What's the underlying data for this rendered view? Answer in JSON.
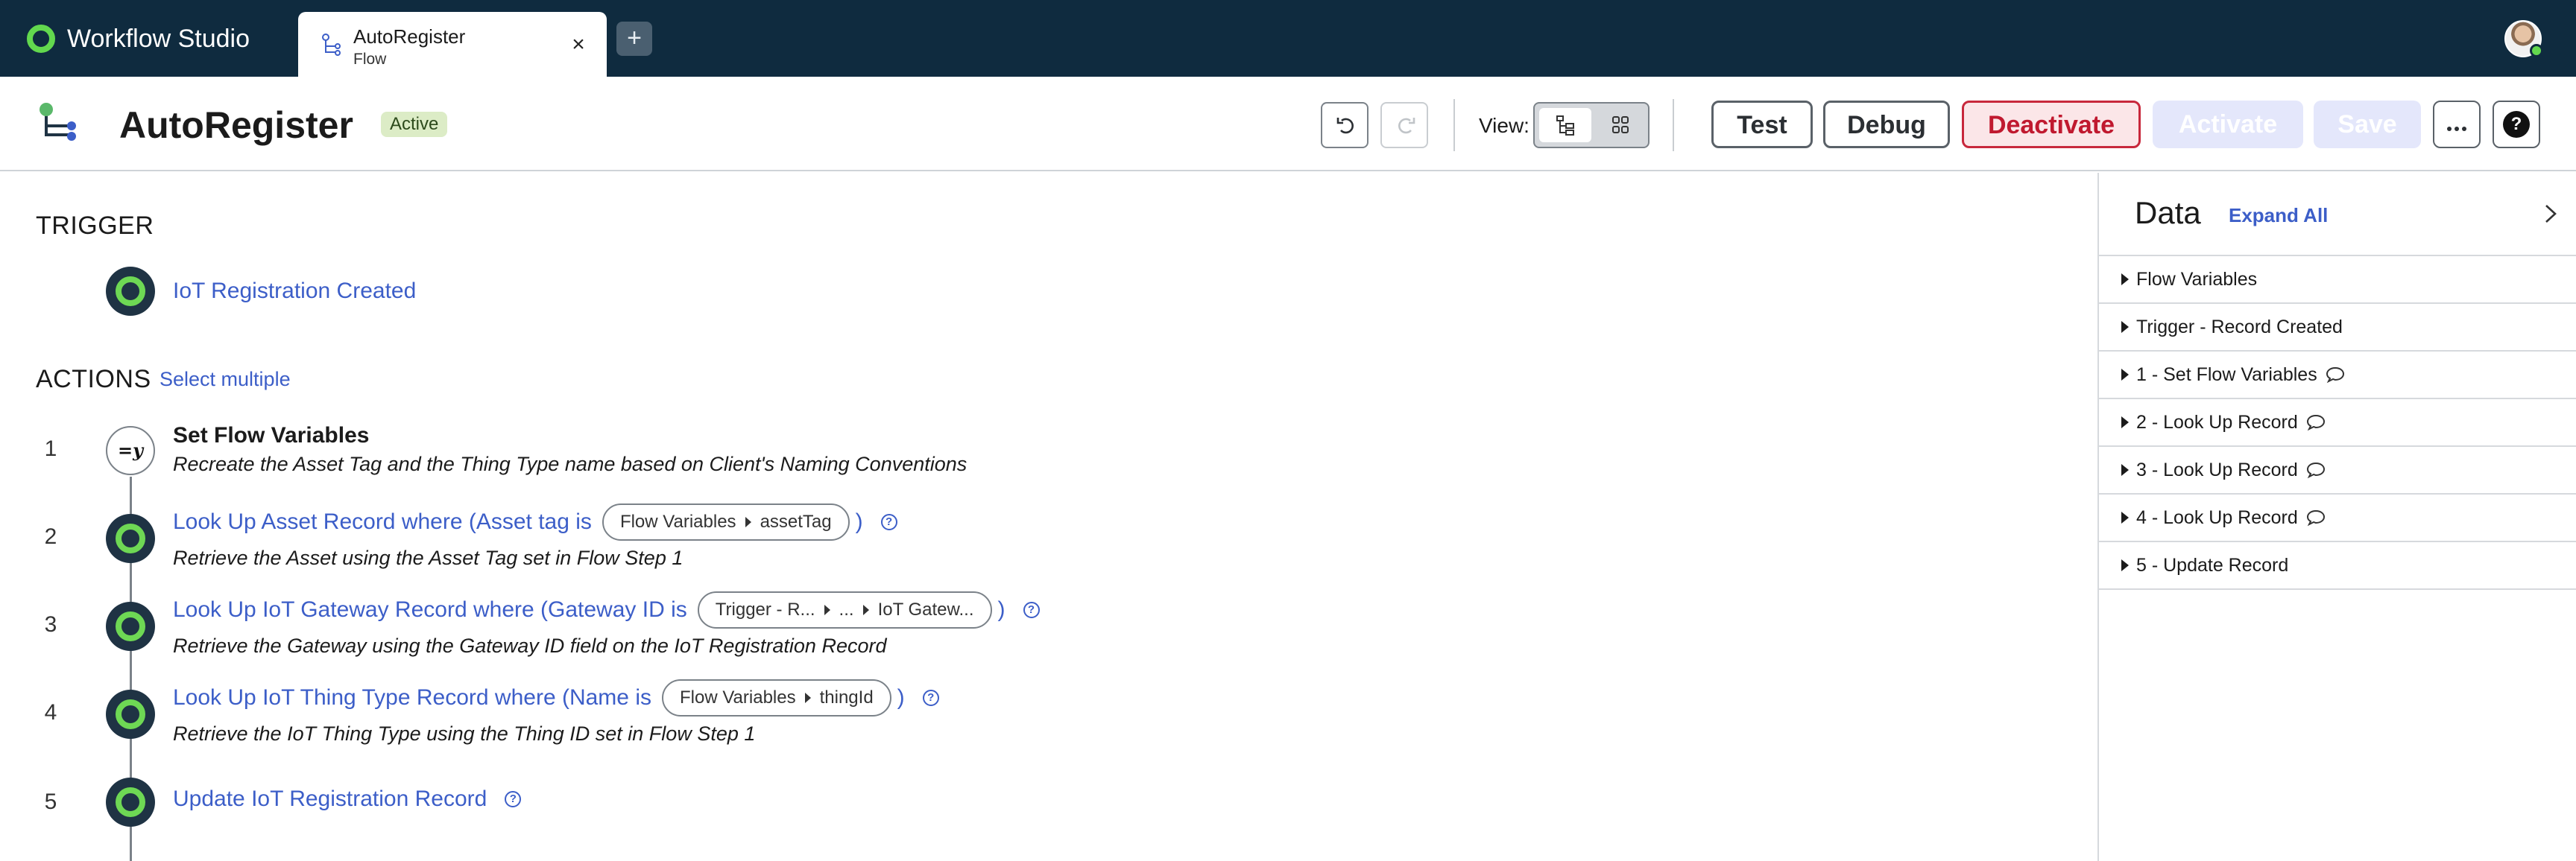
{
  "app": {
    "name": "Workflow Studio",
    "tab": {
      "title": "AutoRegister",
      "subtitle": "Flow",
      "close": "×"
    },
    "new_tab": "+"
  },
  "header": {
    "flow_name": "AutoRegister",
    "status": "Active",
    "view_label": "View:",
    "buttons": {
      "test": "Test",
      "debug": "Debug",
      "deactivate": "Deactivate",
      "activate": "Activate",
      "save": "Save",
      "help": "?"
    }
  },
  "canvas": {
    "trigger_heading": "TRIGGER",
    "trigger": {
      "label": "IoT Registration Created"
    },
    "actions_heading": "ACTIONS",
    "select_multiple": "Select multiple",
    "actions": [
      {
        "number": "1",
        "icon_text": "=y",
        "title": "Set Flow Variables",
        "description": "Recreate the Asset Tag and the Thing Type name based on Client's Naming Conventions"
      },
      {
        "number": "2",
        "title": "Look Up Asset Record where (Asset tag is",
        "pill": [
          "Flow Variables",
          "assetTag"
        ],
        "close_paren": ")",
        "description": "Retrieve the Asset using the Asset Tag set in Flow Step 1"
      },
      {
        "number": "3",
        "title": "Look Up IoT Gateway Record where (Gateway ID is",
        "pill": [
          "Trigger - R...",
          "...",
          "IoT Gatew..."
        ],
        "close_paren": ")",
        "description": "Retrieve the Gateway using the Gateway ID field on the IoT Registration Record"
      },
      {
        "number": "4",
        "title": "Look Up IoT Thing Type Record where (Name is",
        "pill": [
          "Flow Variables",
          "thingId"
        ],
        "close_paren": ")",
        "description": "Retrieve the IoT Thing Type using the Thing ID set in Flow Step 1"
      },
      {
        "number": "5",
        "title": "Update IoT Registration Record"
      }
    ],
    "help_glyph": "?"
  },
  "data_panel": {
    "title": "Data",
    "expand_all": "Expand All",
    "items": [
      {
        "label": "Flow Variables",
        "has_comment": false
      },
      {
        "label": "Trigger - Record Created",
        "has_comment": false
      },
      {
        "label": "1 - Set Flow Variables",
        "has_comment": true
      },
      {
        "label": "2 - Look Up Record",
        "has_comment": true
      },
      {
        "label": "3 - Look Up Record",
        "has_comment": true
      },
      {
        "label": "4 - Look Up Record",
        "has_comment": true
      },
      {
        "label": "5 - Update Record",
        "has_comment": false
      }
    ]
  },
  "colors": {
    "app_bar": "#0f2b3f",
    "accent_green": "#62d84e",
    "link_blue": "#3c5ec8",
    "danger_red": "#c0192f",
    "disabled_button": "#e4e7fb",
    "active_badge": "#dcecc6"
  }
}
